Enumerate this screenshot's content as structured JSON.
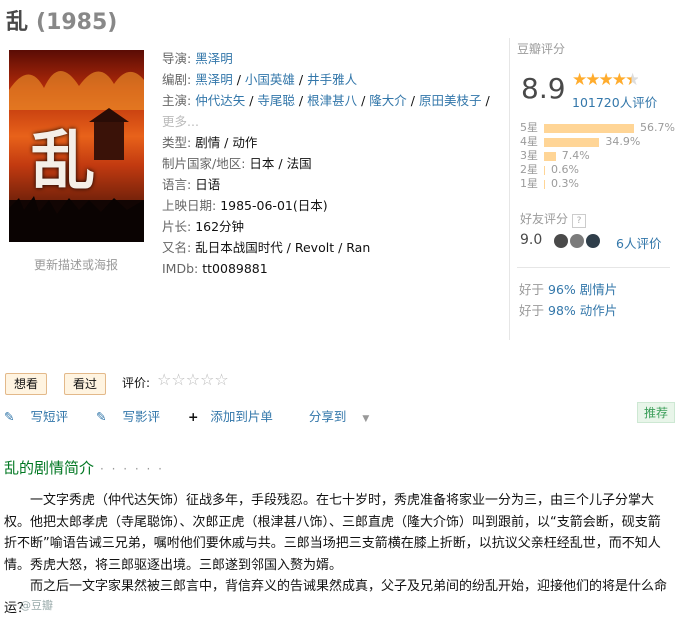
{
  "movie": {
    "title": "乱",
    "year": "(1985)"
  },
  "poster": {
    "link_text": "更新描述或海报",
    "char": "乱"
  },
  "info": {
    "director_key": "导演:",
    "director": "黑泽明",
    "writer_key": "编剧:",
    "writers": [
      "黑泽明",
      "小国英雄",
      "井手雅人"
    ],
    "cast_key": "主演:",
    "cast": [
      "仲代达矢",
      "寺尾聪",
      "根津甚八",
      "隆大介",
      "原田美枝子"
    ],
    "cast_more": "更多...",
    "genre_key": "类型:",
    "genre": "剧情 / 动作",
    "country_key": "制片国家/地区:",
    "country": "日本 / 法国",
    "language_key": "语言:",
    "language": "日语",
    "release_key": "上映日期:",
    "release": "1985-06-01(日本)",
    "runtime_key": "片长:",
    "runtime": "162分钟",
    "aka_key": "又名:",
    "aka": "乱日本战国时代 / Revolt / Ran",
    "imdb_key": "IMDb:",
    "imdb": "tt0089881"
  },
  "rating": {
    "label": "豆瓣评分",
    "score": "8.9",
    "stars_fraction": 0.89,
    "votes": "101720人评价",
    "distribution": [
      {
        "label": "5星",
        "percent": "56.7%",
        "value": 56.7
      },
      {
        "label": "4星",
        "percent": "34.9%",
        "value": 34.9
      },
      {
        "label": "3星",
        "percent": "7.4%",
        "value": 7.4
      },
      {
        "label": "2星",
        "percent": "0.6%",
        "value": 0.6
      },
      {
        "label": "1星",
        "percent": "0.3%",
        "value": 0.3
      }
    ],
    "friend_label": "好友评分",
    "friend_help": "?",
    "friend_score": "9.0",
    "friend_count": "6人评价",
    "better_prefix": "好于",
    "better": [
      {
        "percent": "96%",
        "genre": "剧情片"
      },
      {
        "percent": "98%",
        "genre": "动作片"
      }
    ]
  },
  "actions": {
    "want": "想看",
    "seen": "看过",
    "rate_label": "评价:",
    "short_review": "写短评",
    "review": "写影评",
    "add_list": "添加到片单",
    "share": "分享到",
    "recommend": "推荐"
  },
  "synopsis": {
    "title": "乱的剧情简介",
    "dots": "· · · · · ·",
    "p1": "一文字秀虎（仲代达矢饰）征战多年，手段残忍。在七十岁时，秀虎准备将家业一分为三，由三个儿子分掌大权。他把太郎孝虎（寺尾聪饰）、次郎正虎（根津甚八饰）、三郎直虎（隆大介饰）叫到跟前，以“支箭会断，砚支箭折不断”喻语告诫三兄弟，嘱咐他们要休戚与共。三郎当场把三支箭横在膝上折断，以抗议父亲枉经乱世，而不知人情。秀虎大怒，将三郎驱逐出境。三郎遂到邻国入赘为婿。",
    "p2": "而之后一文字家果然被三郎言中，背信弃义的告诫果然成真，父子及兄弟间的纷乱开始，迎接他们的将是什么命运？",
    "watermark": "@豆瓣"
  }
}
